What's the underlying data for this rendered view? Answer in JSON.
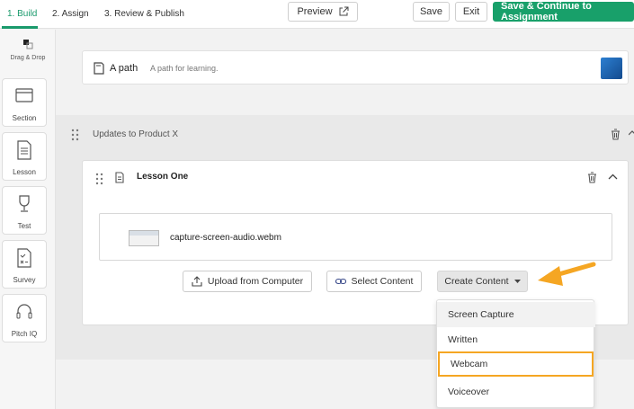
{
  "steps": [
    {
      "label": "1. Build"
    },
    {
      "label": "2. Assign"
    },
    {
      "label": "3. Review & Publish"
    }
  ],
  "header": {
    "preview_label": "Preview",
    "save_label": "Save",
    "exit_label": "Exit",
    "save_continue_label": "Save & Continue to Assignment"
  },
  "sidebar": {
    "drag_drop_label": "Drag & Drop",
    "tools": [
      {
        "label": "Section",
        "icon": "section-icon"
      },
      {
        "label": "Lesson",
        "icon": "document-icon"
      },
      {
        "label": "Test",
        "icon": "trophy-icon"
      },
      {
        "label": "Survey",
        "icon": "survey-icon"
      },
      {
        "label": "Pitch IQ",
        "icon": "headset-icon"
      }
    ]
  },
  "path": {
    "title": "A path",
    "subtitle": "A path for learning."
  },
  "section": {
    "title": "Updates to Product X"
  },
  "lesson": {
    "title": "Lesson One",
    "media_name": "capture-screen-audio.webm"
  },
  "actions": {
    "upload_label": "Upload from Computer",
    "select_label": "Select Content",
    "create_label": "Create Content"
  },
  "dropdown": {
    "items": [
      {
        "label": "Screen Capture"
      },
      {
        "label": "Written"
      },
      {
        "label": "Webcam"
      },
      {
        "label": "Voiceover"
      }
    ]
  },
  "colors": {
    "accent_green": "#18a06a",
    "highlight_orange": "#f5a623"
  }
}
